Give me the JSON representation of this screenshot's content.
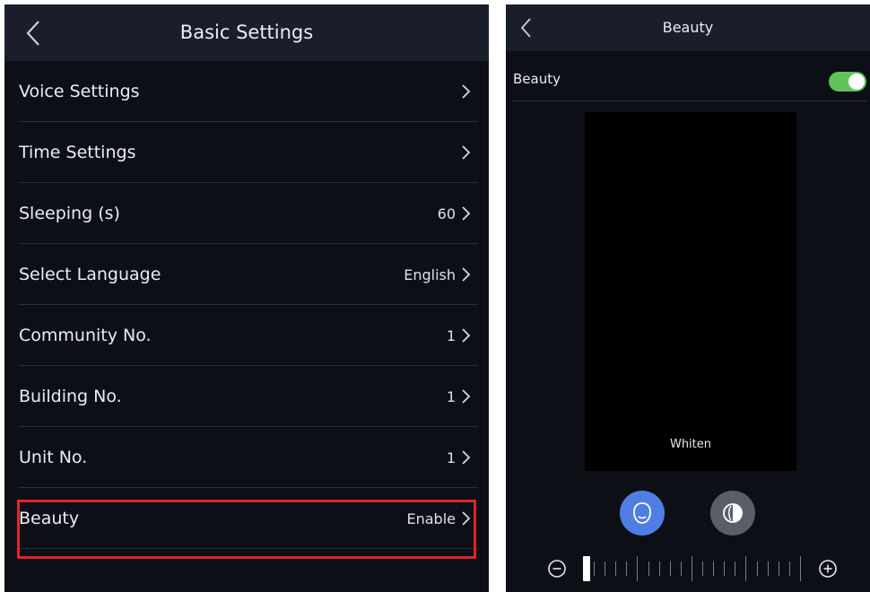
{
  "basic_settings": {
    "title": "Basic Settings",
    "rows": [
      {
        "label": "Voice Settings",
        "value": ""
      },
      {
        "label": "Time Settings",
        "value": ""
      },
      {
        "label": "Sleeping (s)",
        "value": "60"
      },
      {
        "label": "Select Language",
        "value": "English"
      },
      {
        "label": "Community No.",
        "value": "1"
      },
      {
        "label": "Building No.",
        "value": "1"
      },
      {
        "label": "Unit No.",
        "value": "1"
      },
      {
        "label": "Beauty",
        "value": "Enable"
      }
    ],
    "highlighted_row": "Beauty"
  },
  "beauty_page": {
    "title": "Beauty",
    "toggle_label": "Beauty",
    "toggle_on": true,
    "preview_label": "Whiten",
    "active_mode": "whiten",
    "modes": [
      {
        "icon": "face-outline-icon"
      },
      {
        "icon": "contrast-half-icon"
      }
    ],
    "slider_level": 0
  },
  "colors": {
    "accent_blue": "#4f7fe2",
    "toggle_green": "#5fc35a",
    "highlight_red": "#e0242c",
    "background": "#0d0f17",
    "header_background": "#1a1d2a"
  }
}
